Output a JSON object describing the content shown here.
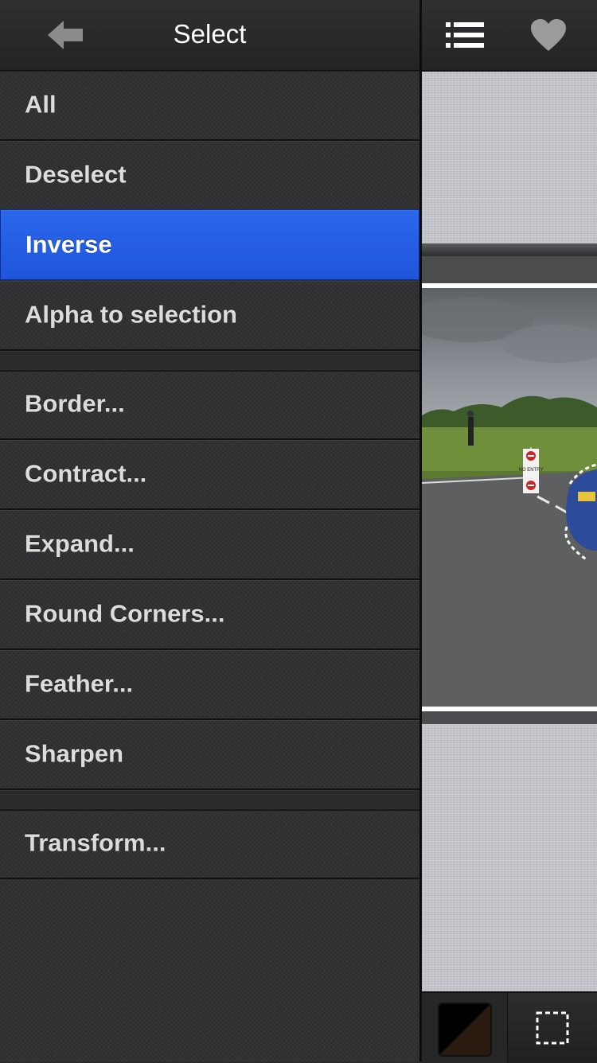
{
  "header": {
    "title": "Select"
  },
  "menu": {
    "items": [
      {
        "label": "All"
      },
      {
        "label": "Deselect"
      },
      {
        "label": "Inverse",
        "active": true
      },
      {
        "label": "Alpha to selection"
      },
      {
        "label": "Border..."
      },
      {
        "label": "Contract..."
      },
      {
        "label": "Expand..."
      },
      {
        "label": "Round Corners..."
      },
      {
        "label": "Feather..."
      },
      {
        "label": "Sharpen"
      },
      {
        "label": "Transform..."
      }
    ]
  },
  "photo": {
    "sign_text": "NO ENTRY"
  },
  "colors": {
    "accent": "#2363e6",
    "panel": "#2e2f30",
    "text": "#dcdcdc"
  },
  "icons": {
    "back": "back-arrow-icon",
    "list": "list-icon",
    "favorite": "heart-icon",
    "color": "color-swatch",
    "select_tool": "marquee-select-icon"
  }
}
